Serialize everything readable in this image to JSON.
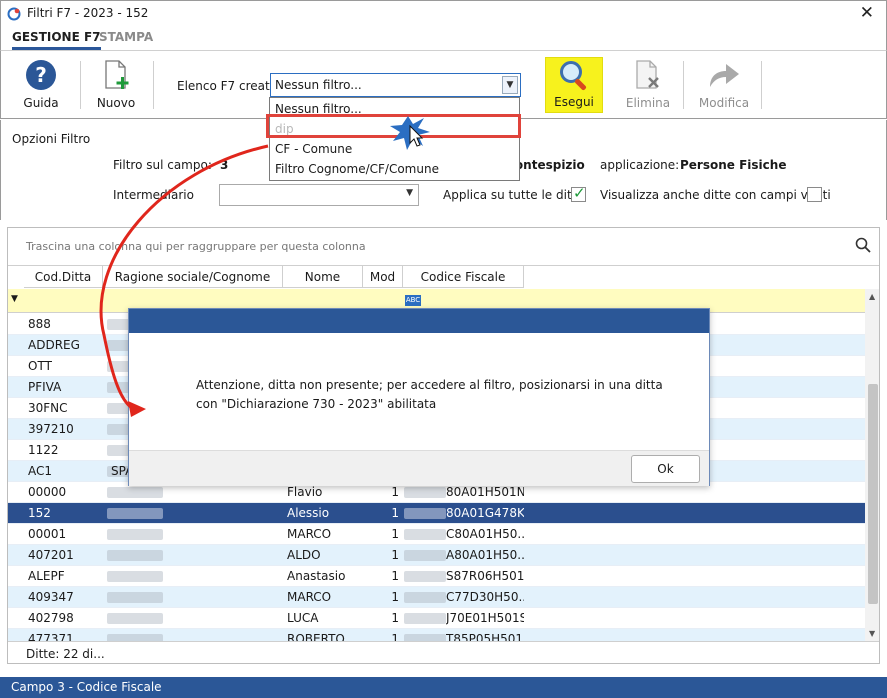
{
  "window": {
    "title": "Filtri F7 - 2023 - 152",
    "close": "✕"
  },
  "tabs": [
    {
      "label": "GESTIONE F7"
    },
    {
      "label": "STAMPA"
    }
  ],
  "ribbon": {
    "guida": "Guida",
    "nuovo": "Nuovo",
    "filter_label": "Elenco F7 creati",
    "filter_value": "Nessun filtro...",
    "esegui": "Esegui",
    "elimina": "Elimina",
    "modifica": "Modifica"
  },
  "dropdown": {
    "items": [
      {
        "label": "Nessun filtro..."
      },
      {
        "label": "dip"
      },
      {
        "label": "CF - Comune"
      },
      {
        "label": "Filtro Cognome/CF/Comune"
      }
    ]
  },
  "options": {
    "header": "Opzioni Filtro",
    "campo_label": "Filtro sul campo:",
    "campo_value": "3",
    "frontespizio": "rontespizio",
    "applicazione_label": "applicazione:",
    "applicazione_value": "Persone Fisiche",
    "intermediario_label": "Intermediario",
    "applica_label": "Applica su tutte le ditte",
    "visualizza_label": "Visualizza anche ditte con campi vuoti"
  },
  "grid": {
    "group_hint": "Trascina una colonna qui per raggruppare per questa colonna",
    "columns": [
      "Cod.Ditta",
      "Ragione sociale/Cognome",
      "Nome",
      "Mod",
      "Codice Fiscale"
    ],
    "filter_abc": "ABC",
    "rows": [
      {
        "cod": "888",
        "nome": "",
        "mod": "",
        "cf": ""
      },
      {
        "cod": "ADDREG",
        "nome": "",
        "mod": "",
        "cf": ""
      },
      {
        "cod": "OTT",
        "nome": "",
        "mod": "",
        "cf": ""
      },
      {
        "cod": "PFIVA",
        "nome": "",
        "mod": "",
        "cf": ""
      },
      {
        "cod": "30FNC",
        "nome": "",
        "mod": "",
        "cf": ""
      },
      {
        "cod": "397210",
        "nome": "",
        "mod": "",
        "cf": ""
      },
      {
        "cod": "1122",
        "nome": "",
        "mod": "",
        "cf": ""
      },
      {
        "cod": "AC1",
        "ragione": "SPA",
        "nome": "",
        "mod": "",
        "cf": ""
      },
      {
        "cod": "00000",
        "nome": "Flavio",
        "mod": "1",
        "cf": "80A01H501N"
      },
      {
        "cod": "152",
        "nome": "Alessio",
        "mod": "1",
        "cf": "80A01G478K",
        "selected": true
      },
      {
        "cod": "00001",
        "nome": "MARCO",
        "mod": "1",
        "cf": "C80A01H50..."
      },
      {
        "cod": "407201",
        "nome": "ALDO",
        "mod": "1",
        "cf": "A80A01H50..."
      },
      {
        "cod": "ALEPF",
        "nome": "Anastasio",
        "mod": "1",
        "cf": "S87R06H501A"
      },
      {
        "cod": "409347",
        "nome": "MARCO",
        "mod": "1",
        "cf": "C77D30H50..."
      },
      {
        "cod": "402798",
        "nome": "LUCA",
        "mod": "1",
        "cf": "J70E01H501S"
      },
      {
        "cod": "477371",
        "nome": "ROBERTO",
        "mod": "1",
        "cf": "T85P05H501..."
      }
    ],
    "footer": "Ditte: 22 di..."
  },
  "status_bar": "Campo 3 - Codice Fiscale",
  "modal": {
    "message": "Attenzione, ditta non presente; per accedere al filtro, posizionarsi in una ditta con \"Dichiarazione 730 - 2023\" abilitata",
    "ok": "Ok"
  },
  "colors": {
    "accent": "#2b5797",
    "selection": "#2b4f8e",
    "highlight": "#e0433b",
    "alt_row": "#e3f2fc",
    "filter_row": "#fffcc0"
  }
}
